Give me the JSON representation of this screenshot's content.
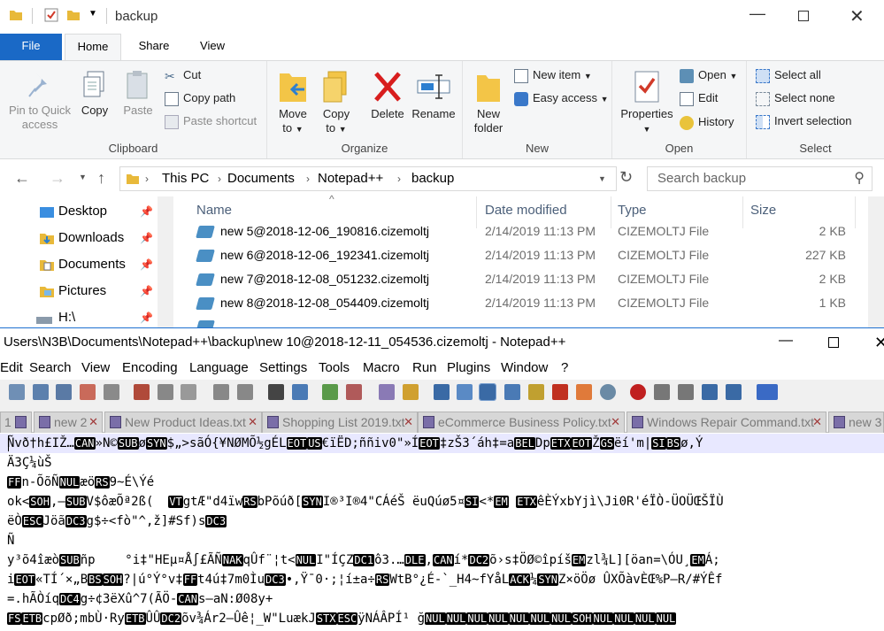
{
  "explorer": {
    "title": "backup",
    "tabs": {
      "file": "File",
      "home": "Home",
      "share": "Share",
      "view": "View"
    },
    "clipboard": {
      "pin": "Pin to Quick access",
      "pin_l1": "Pin to Quick",
      "pin_l2": "access",
      "copy": "Copy",
      "paste": "Paste",
      "cut": "Cut",
      "copy_path": "Copy path",
      "paste_shortcut": "Paste shortcut",
      "label": "Clipboard"
    },
    "organize": {
      "move_l1": "Move",
      "move_l2": "to",
      "copy_l1": "Copy",
      "copy_l2": "to",
      "delete": "Delete",
      "rename": "Rename",
      "label": "Organize"
    },
    "new": {
      "folder_l1": "New",
      "folder_l2": "folder",
      "new_item": "New item",
      "easy_access": "Easy access",
      "label": "New"
    },
    "open": {
      "properties": "Properties",
      "open": "Open",
      "edit": "Edit",
      "history": "History",
      "label": "Open"
    },
    "select": {
      "select_all": "Select all",
      "select_none": "Select none",
      "invert": "Invert selection",
      "label": "Select"
    },
    "address": {
      "crumbs": [
        "This PC",
        "Documents",
        "Notepad++",
        "backup"
      ]
    },
    "search": {
      "placeholder": "Search backup"
    },
    "nav": [
      "Desktop",
      "Downloads",
      "Documents",
      "Pictures",
      "H:\\"
    ],
    "columns": {
      "name": "Name",
      "date": "Date modified",
      "type": "Type",
      "size": "Size"
    },
    "files": [
      {
        "name": "new 5@2018-12-06_190816.cizemoltj",
        "date": "2/14/2019 11:13 PM",
        "type": "CIZEMOLTJ File",
        "size": "2 KB"
      },
      {
        "name": "new 6@2018-12-06_192341.cizemoltj",
        "date": "2/14/2019 11:13 PM",
        "type": "CIZEMOLTJ File",
        "size": "227 KB"
      },
      {
        "name": "new 7@2018-12-08_051232.cizemoltj",
        "date": "2/14/2019 11:13 PM",
        "type": "CIZEMOLTJ File",
        "size": "2 KB"
      },
      {
        "name": "new 8@2018-12-08_054409.cizemoltj",
        "date": "2/14/2019 11:13 PM",
        "type": "CIZEMOLTJ File",
        "size": "1 KB"
      }
    ]
  },
  "notepad": {
    "title": "Users\\N3B\\Documents\\Notepad++\\backup\\new 10@2018-12-11_054536.cizemoltj - Notepad++",
    "menu": [
      "Edit",
      "Search",
      "View",
      "Encoding",
      "Language",
      "Settings",
      "Tools",
      "Macro",
      "Run",
      "Plugins",
      "Window",
      "?"
    ],
    "tabs": [
      "1",
      "new 2",
      "New Product Ideas.txt",
      "Shopping List 2019.txt",
      "eCommerce Business Policy.txt",
      "Windows Repair Command.txt",
      "new 3"
    ],
    "lines": [
      [
        "Ñvð†h£IŽ…",
        "{CAN}",
        "»N©",
        "{SUB}",
        "ø",
        "{SYN}",
        "$„>sãÓ{¥NØMÕ½gÉL",
        "{EOT}",
        "",
        "{US}",
        "€ïËD;ññiv0\"»Í",
        "{EOT}",
        "‡zŠ3´áh‡=a",
        "{BEL}",
        "Dp",
        "{ETX}",
        "",
        "{EOT}",
        "Ž",
        "{GS}",
        "ëí'm|",
        "{SI}",
        "",
        "{BS}",
        "ø‚Ý"
      ],
      [
        "Ä3Ç¼ùŠ"
      ],
      [
        "",
        "{FF}",
        "n-ÕõÑ",
        "{NUL}",
        "æö",
        "{RS}",
        "9~É\\Ýé"
      ],
      [
        "ok<",
        "{SOH}",
        ",–",
        "{SUB}",
        "V$ôæÕª2ß(  ",
        "{VT}",
        "gtÆ\"d4ïw",
        "{RS}",
        "bPõúð[",
        "{SYN}",
        "I®³I®4\"CÁéŠ ëuQúø5¤",
        "{SI}",
        "<*",
        "{EM}",
        " ",
        "{ETX}",
        "êÈÝxbYjì\\Ji0R'éÏÒ-ÜOÜŒŠÏÙ"
      ],
      [
        "ëÒ",
        "{ESC}",
        "Jöã",
        "{DC3}",
        "g$÷<fò\"^,ž]#Sf)s",
        "{DC3}"
      ],
      [
        "Ñ"
      ],
      [
        "y³õ4îæò",
        "{SUB}",
        "ñp    °i‡\"HEµ¤Å∫£ÃÑ",
        "{NAK}",
        "qÛf¨¦t<",
        "{NUL}",
        "I\"ÍÇZ",
        "{DC1}",
        "ô3.…",
        "{DLE}",
        ",",
        "{CAN}",
        "í*",
        "{DC2}",
        "õ›s‡ÖØ©îpíš",
        "{EM}",
        "zl¾L][öan=\\ÓU¸",
        "{EM}",
        "Á;"
      ],
      [
        "i",
        "{EOT}",
        "«TÍ´×„B",
        "{BS}",
        "",
        "{SOH}",
        "?|ú°Ý°v‡",
        "{FF}",
        "t4ú‡7m0Ìu",
        "{DC3}",
        "•,Ÿ¯0·;¦í±a÷",
        "{RS}",
        "WtB°¿É-`_H4~fYåL",
        "{ACK}",
        "¼",
        "{SYN}",
        "Z×öÖø ÛXÕàvÈŒ%P—R/#ÝÊf"
      ],
      [
        "=.hÃÒíq",
        "{DC4}",
        "g÷¢3ëXû^7(ÃÖ-",
        "{CAN}",
        "s—aN:Ø08y+"
      ],
      [
        "",
        "{FS}",
        "",
        "{ETB}",
        "cpØð;mbÙ·Ry",
        "{ETB}",
        "ÛÛ",
        "{DC2}",
        "õv¾Ár2–Ûê¦_W\"LuækJ",
        "{STX}",
        "",
        "{ESC}",
        "ÿNÁÂPÍ¹ ğ",
        "{NUL}",
        "",
        "{NUL}",
        "",
        "{NUL}",
        "",
        "{NUL}",
        "",
        "{NUL}",
        "",
        "{NUL}",
        "",
        "{NUL}",
        "",
        "{SOH}",
        "",
        "{NUL}",
        "",
        "{NUL}",
        "",
        "{NUL}",
        "",
        "{NUL}"
      ]
    ]
  }
}
